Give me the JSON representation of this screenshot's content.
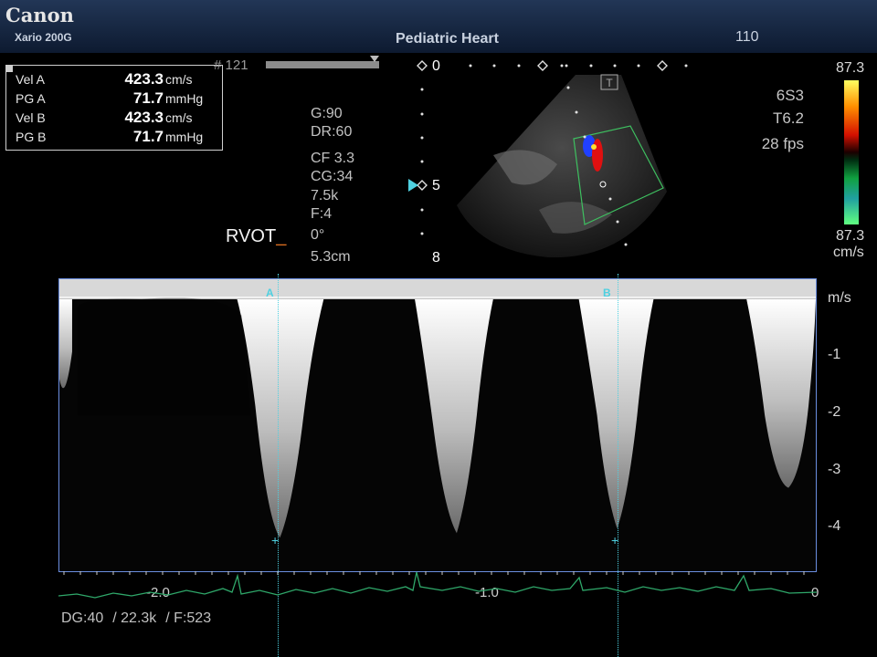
{
  "header": {
    "brand": "Canon",
    "model": "Xario 200G",
    "preset": "Pediatric Heart",
    "frame_number": "110"
  },
  "measurements": [
    {
      "label": "Vel A",
      "value": "423.3",
      "unit": "cm/s"
    },
    {
      "label": "PG A",
      "value": "71.7",
      "unit": "mmHg"
    },
    {
      "label": "Vel B",
      "value": "423.3",
      "unit": "cm/s"
    },
    {
      "label": "PG B",
      "value": "71.7",
      "unit": "mmHg"
    }
  ],
  "cine": {
    "label": "# 121"
  },
  "imaging_params": [
    "G:90",
    "DR:60",
    "CF 3.3",
    "CG:34",
    "7.5k",
    "F:4",
    "0°",
    "5.3cm"
  ],
  "view_label": "RVOT",
  "view_cursor": "_",
  "depth_marks": [
    "0",
    "5",
    "8"
  ],
  "probe": {
    "transducer": "6S3",
    "harmonic": "T6.2",
    "frame_rate": "28 fps"
  },
  "color_scale": {
    "top": "87.3",
    "bottom": "87.3",
    "unit": "cm/s",
    "accent": "#ff3010"
  },
  "markers": {
    "a": "A",
    "b": "B",
    "accent": "#4fd0e0"
  },
  "spectral": {
    "velocity_unit": "m/s",
    "velocity_ticks": [
      "-1",
      "-2",
      "-3",
      "-4"
    ],
    "time_ticks": [
      "-2.0",
      "-1.0",
      "0"
    ],
    "trace_color": "#2fa86a"
  },
  "footer": {
    "dg": "DG:40",
    "prf": "/ 22.3k",
    "filter": "/ F:523"
  }
}
